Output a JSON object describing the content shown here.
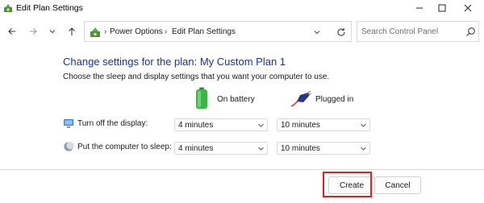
{
  "window": {
    "title": "Edit Plan Settings"
  },
  "nav": {
    "breadcrumb": [
      "Power Options",
      "Edit Plan Settings"
    ],
    "breadcrumb_separator": "›",
    "search_placeholder": "Search Control Panel"
  },
  "content": {
    "heading": "Change settings for the plan: My Custom Plan 1",
    "subheading": "Choose the sleep and display settings that you want your computer to use.",
    "columns": {
      "battery": "On battery",
      "plugged": "Plugged in"
    },
    "rows": [
      {
        "label": "Turn off the display:",
        "battery": "4 minutes",
        "plugged": "10 minutes"
      },
      {
        "label": "Put the computer to sleep:",
        "battery": "4 minutes",
        "plugged": "10 minutes"
      }
    ]
  },
  "buttons": {
    "create": "Create",
    "cancel": "Cancel"
  },
  "colors": {
    "heading": "#1e3287",
    "highlight": "#d8232a",
    "battery_green": "#3bb54a"
  },
  "icons": {
    "title": "power-options-icon",
    "window": [
      "minimize-icon",
      "maximize-icon",
      "close-icon"
    ],
    "nav": [
      "back-arrow-icon",
      "forward-arrow-icon",
      "chevron-down-icon",
      "up-arrow-icon",
      "refresh-icon",
      "search-icon"
    ],
    "rows": [
      "display-icon",
      "sleep-moon-icon"
    ],
    "columns": [
      "battery-icon",
      "power-plug-icon"
    ]
  }
}
